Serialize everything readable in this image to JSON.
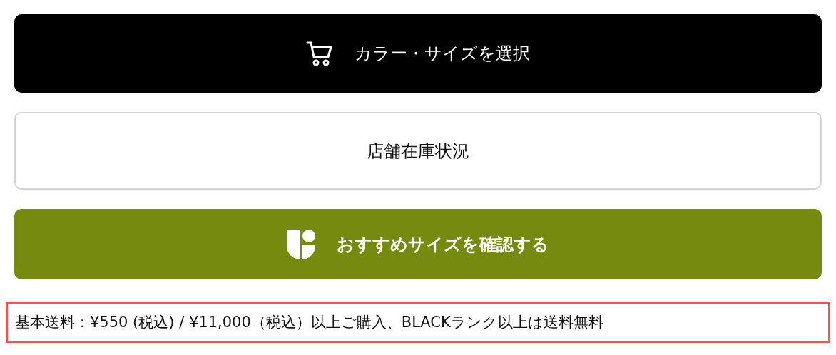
{
  "buttons": [
    {
      "kind": "cart",
      "label": "カラー・サイズを選択"
    },
    {
      "kind": "outline",
      "label": "店舗在庫状況"
    },
    {
      "kind": "size",
      "label": "おすすめサイズを確認する"
    }
  ],
  "shipping_note": "基本送料：¥550 (税込) / ¥11,000（税込）以上ご購入、BLACKランク以上は送料無料"
}
